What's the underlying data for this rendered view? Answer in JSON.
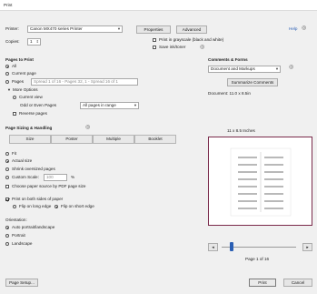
{
  "window": {
    "title": "Print"
  },
  "header": {
    "printer_label": "Printer:",
    "printer_value": "Canon MX470 series Printer",
    "properties_label": "Properties",
    "advanced_label": "Advanced",
    "help_label": "Help",
    "copies_label": "Copies:",
    "copies_value": "1",
    "grayscale_label": "Print in grayscale (black and white)",
    "save_ink_label": "Save ink/toner"
  },
  "pages_to_print": {
    "heading": "Pages to Print",
    "all_label": "All",
    "current_page_label": "Current page",
    "pages_label": "Pages",
    "pages_value": "Spread 1 of 16 - Pages 32, 1 - Spread 16 of 1",
    "more_options_label": "More Options",
    "current_view_label": "Current view",
    "odd_even_label": "Odd or Even Pages",
    "odd_even_value": "All pages in range",
    "reverse_label": "Reverse pages"
  },
  "page_sizing": {
    "heading": "Page Sizing & Handling",
    "tabs": [
      "Size",
      "Poster",
      "Multiple",
      "Booklet"
    ],
    "fit_label": "Fit",
    "actual_size_label": "Actual size",
    "shrink_label": "Shrink oversized pages",
    "custom_scale_label": "Custom Scale:",
    "custom_scale_value": "100",
    "percent": "%",
    "choose_source_label": "Choose paper source by PDF page size",
    "both_sides_label": "Print on both sides of paper",
    "flip_long_label": "Flip on long edge",
    "flip_short_label": "Flip on short edge"
  },
  "orientation": {
    "heading": "Orientation:",
    "auto_label": "Auto portrait/landscape",
    "portrait_label": "Portrait",
    "landscape_label": "Landscape"
  },
  "comments": {
    "heading": "Comments & Forms",
    "select_value": "Document and Markups",
    "summarize_label": "Summarize Comments",
    "document_size": "Document: 11.0 x 8.5in",
    "preview_size": "11 x 8.5 Inches"
  },
  "navigation": {
    "page_indicator": "Page 1 of 16"
  },
  "footer": {
    "page_setup_label": "Page Setup...",
    "print_label": "Print",
    "cancel_label": "Cancel"
  }
}
